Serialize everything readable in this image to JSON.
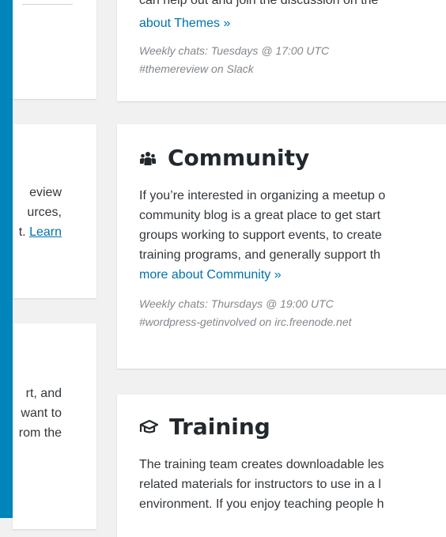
{
  "left_cards": {
    "card2_lines": [
      "eview",
      "urces,",
      "t.",
      "Learn"
    ],
    "card3_lines": [
      "rt, and",
      "want to",
      "rom the"
    ]
  },
  "themes": {
    "partial_line": "can help out and join the discussion on the",
    "link": "about Themes »",
    "chat_time": "Weekly chats: Tuesdays @ 17:00 UTC",
    "chat_channel": "#themereview on Slack"
  },
  "community": {
    "icon": "groups-icon",
    "title": "Community",
    "lines": [
      "If you’re interested in organizing a meetup o",
      "community blog is a great place to get start",
      "groups working to support events, to create",
      "training programs, and generally support th"
    ],
    "link": "more about Community »",
    "chat_time": "Weekly chats: Thursdays @ 19:00 UTC",
    "chat_channel": "#wordpress-getinvolved on irc.freenode.net"
  },
  "training": {
    "icon": "graduation-cap-icon",
    "title": "Training",
    "lines": [
      "The training team creates downloadable les",
      "related materials for instructors to use in a l",
      "environment. If you enjoy teaching people h"
    ]
  },
  "colors": {
    "sidebar": "#0085ba",
    "link": "#0073aa",
    "background": "#f1f1f1"
  }
}
